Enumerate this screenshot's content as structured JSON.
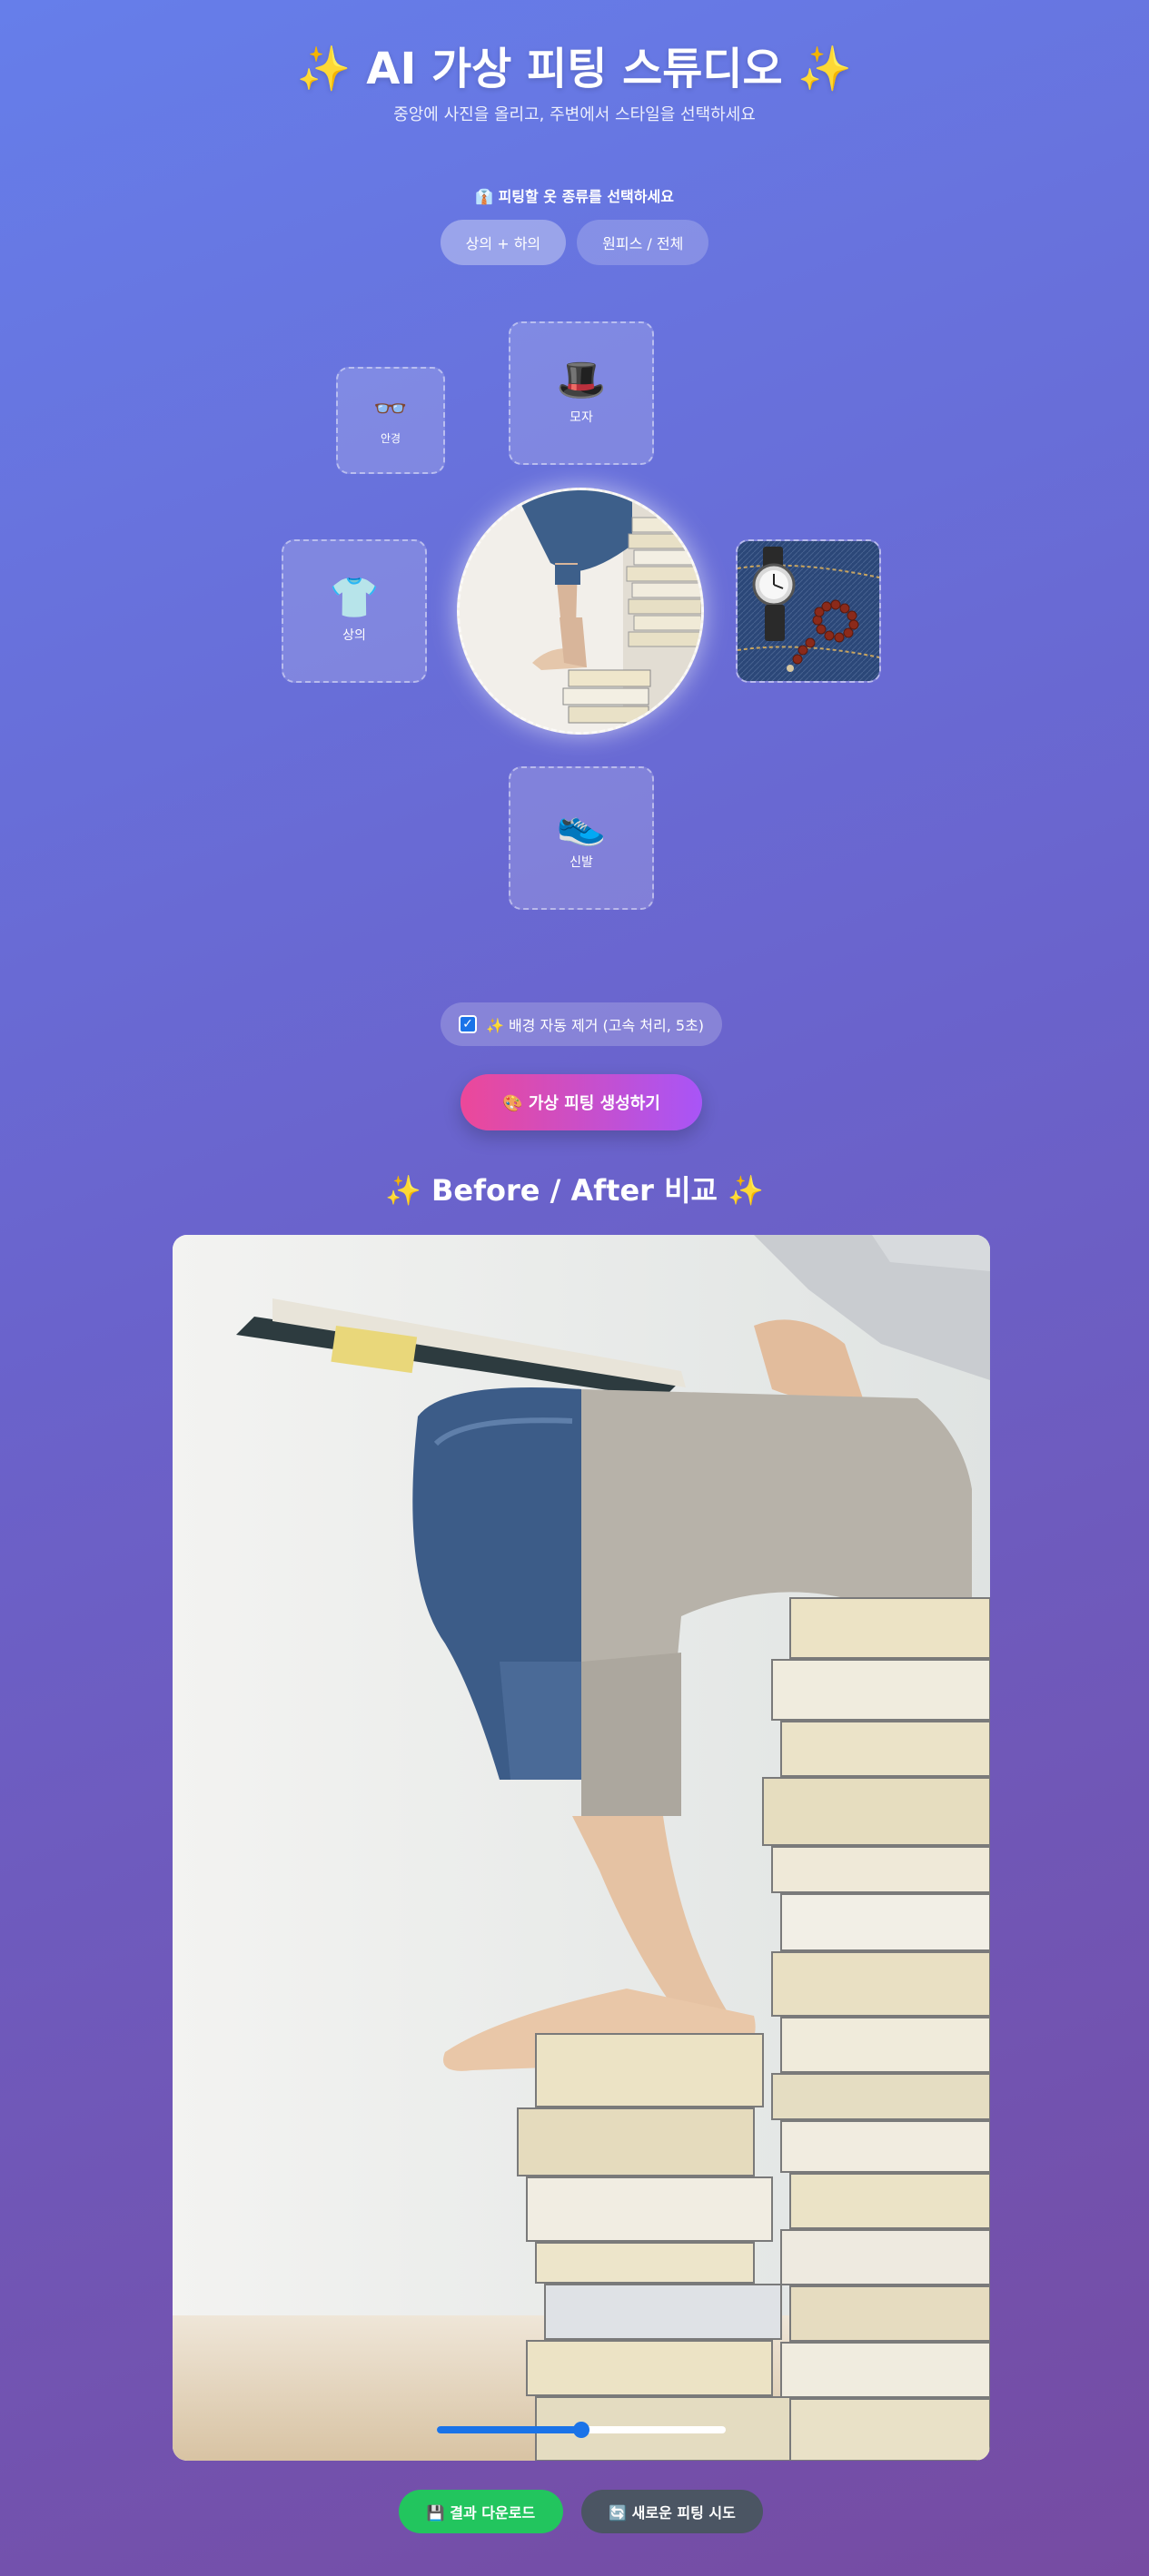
{
  "header": {
    "title": "✨ AI 가상 피팅 스튜디오 ✨",
    "subtitle": "중앙에 사진을 올리고, 주변에서 스타일을 선택하세요"
  },
  "clothing_type": {
    "label": "👔 피팅할 옷 종류를 선택하세요",
    "options": [
      "상의 + 하의",
      "원피스 / 전체"
    ],
    "selected": "상의 + 하의"
  },
  "slots": {
    "hat": {
      "icon": "🎩",
      "label": "모자"
    },
    "glasses": {
      "icon": "👓",
      "label": "안경"
    },
    "top": {
      "icon": "👕",
      "label": "상의"
    },
    "shoes": {
      "icon": "👟",
      "label": "신발"
    },
    "bottom": {
      "icon": "jeans-watch-photo"
    }
  },
  "center": {
    "icon": "person-sitting-on-books-photo"
  },
  "background_removal": {
    "checked": true,
    "label": "✨ 배경 자동 제거 (고속 처리, 5초)"
  },
  "generate_button": "🎨 가상 피팅 생성하기",
  "comparison": {
    "title": "✨ Before / After 비교 ✨",
    "slider_position": 0.5
  },
  "actions": {
    "download": "💾 결과 다운로드",
    "retry": "🔄 새로운 피팅 시도"
  },
  "colors": {
    "accent": "#1a73e8",
    "download": "#22c55e",
    "retry": "#4b5563"
  }
}
